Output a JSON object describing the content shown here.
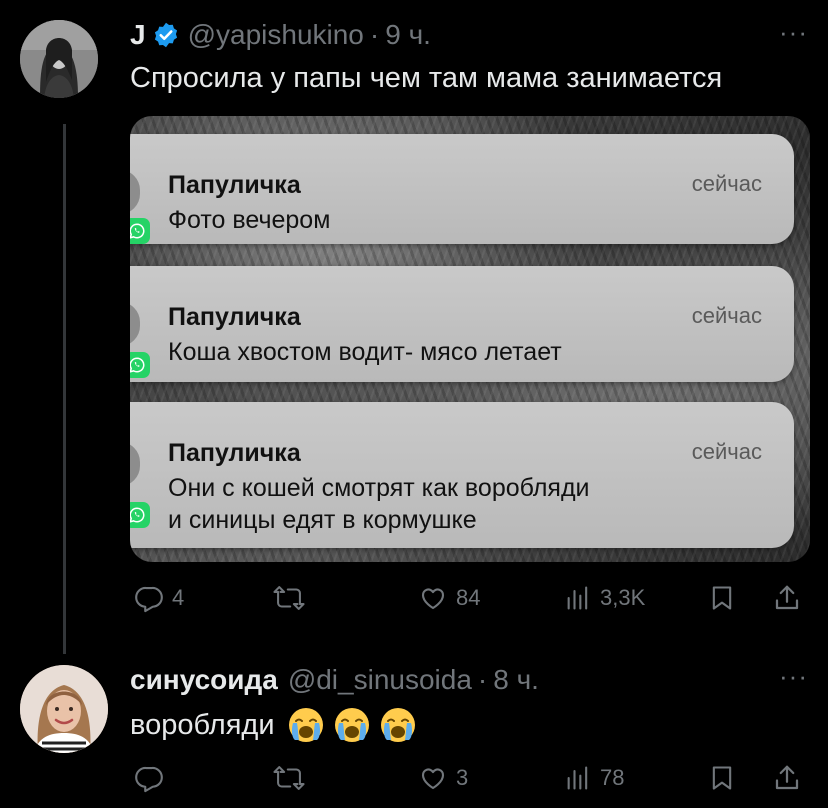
{
  "tweets": [
    {
      "name": "J",
      "handle": "@yapishukino",
      "dot": "·",
      "time": "9 ч.",
      "text": "Спросила у папы чем там мама занимается",
      "more": "···",
      "notifications": [
        {
          "title": "Папуличка",
          "time": "сейчас",
          "body_lines": [
            "Фото вечером"
          ]
        },
        {
          "title": "Папуличка",
          "time": "сейчас",
          "body_lines": [
            "Коша хвостом водит- мясо летает"
          ]
        },
        {
          "title": "Папуличка",
          "time": "сейчас",
          "body_lines": [
            "Они с кошей смотрят как воробляди",
            "и синицы едят в кормушке"
          ]
        }
      ],
      "actions": {
        "replies": "4",
        "retweets": "",
        "likes": "84",
        "views": "3,3K"
      }
    },
    {
      "name": "синусоида",
      "handle": "@di_sinusoida",
      "dot": "·",
      "time": "8 ч.",
      "text": "воробляди",
      "emojis": [
        "loudly-crying-face",
        "loudly-crying-face",
        "loudly-crying-face"
      ],
      "more": "···",
      "actions": {
        "replies": "",
        "retweets": "",
        "likes": "3",
        "views": "78"
      }
    }
  ],
  "colors": {
    "background": "#000000",
    "text": "#e7e9ea",
    "secondary": "#71767b",
    "verified": "#1d9bf0",
    "whatsapp": "#25d366"
  },
  "icons": {
    "reply": "reply-icon",
    "retweet": "retweet-icon",
    "like": "heart-icon",
    "views": "views-icon",
    "bookmark": "bookmark-icon",
    "share": "share-icon",
    "verified": "verified-badge-icon",
    "app": "whatsapp-icon"
  }
}
